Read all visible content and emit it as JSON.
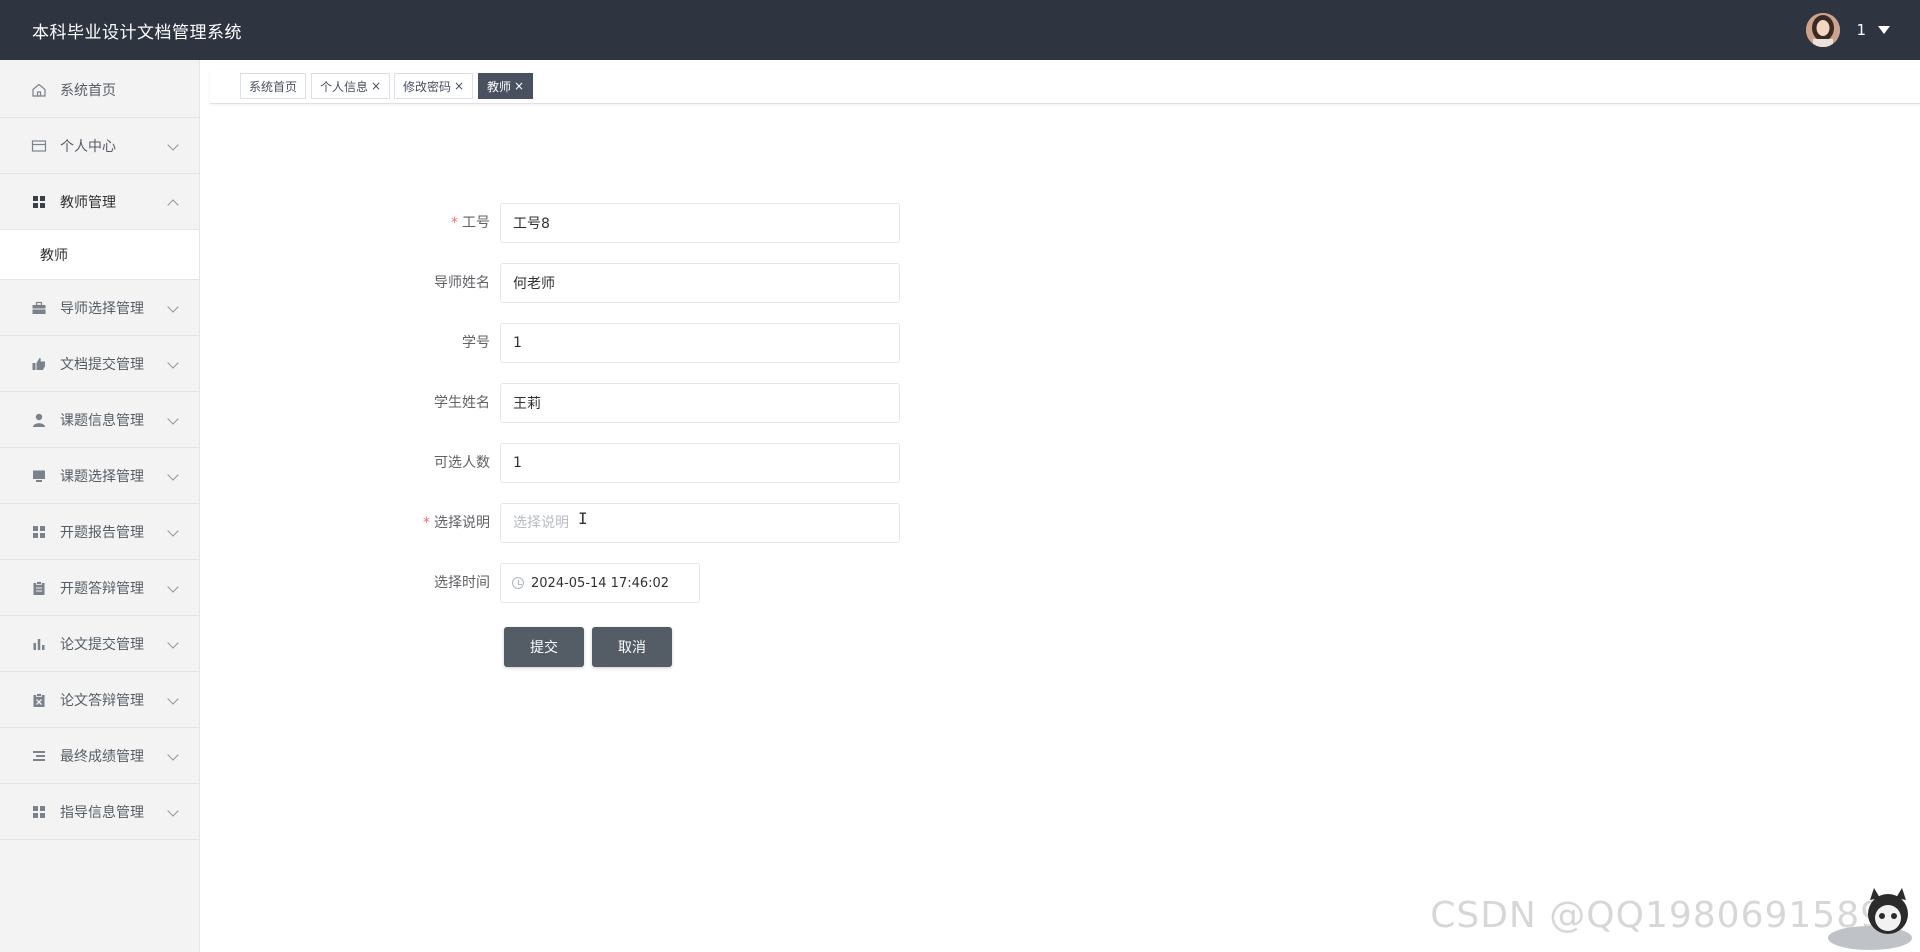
{
  "header": {
    "title": "本科毕业设计文档管理系统",
    "user_name": "1"
  },
  "sidebar": {
    "items": [
      {
        "label": "系统首页",
        "icon": "home-icon"
      },
      {
        "label": "个人中心",
        "icon": "card-icon"
      },
      {
        "label": "教师管理",
        "icon": "grid-icon",
        "expanded": true
      },
      {
        "label": "导师选择管理",
        "icon": "briefcase-icon"
      },
      {
        "label": "文档提交管理",
        "icon": "thumb-icon"
      },
      {
        "label": "课题信息管理",
        "icon": "user-icon"
      },
      {
        "label": "课题选择管理",
        "icon": "monitor-icon"
      },
      {
        "label": "开题报告管理",
        "icon": "grid-icon"
      },
      {
        "label": "开题答辩管理",
        "icon": "clipboard-icon"
      },
      {
        "label": "论文提交管理",
        "icon": "bar-chart-icon"
      },
      {
        "label": "论文答辩管理",
        "icon": "clipboard-x-icon"
      },
      {
        "label": "最终成绩管理",
        "icon": "list-icon"
      },
      {
        "label": "指导信息管理",
        "icon": "grid-icon"
      }
    ],
    "submenu": {
      "label": "教师"
    }
  },
  "tags": [
    {
      "label": "系统首页",
      "closable": false,
      "active": false
    },
    {
      "label": "个人信息",
      "closable": true,
      "active": false
    },
    {
      "label": "修改密码",
      "closable": true,
      "active": false
    },
    {
      "label": "教师",
      "closable": true,
      "active": true
    }
  ],
  "tag_close_glyph": "×",
  "form": {
    "fields": [
      {
        "label": "工号",
        "required": true,
        "value": "工号8",
        "placeholder": ""
      },
      {
        "label": "导师姓名",
        "required": false,
        "value": "何老师",
        "placeholder": ""
      },
      {
        "label": "学号",
        "required": false,
        "value": "1",
        "placeholder": ""
      },
      {
        "label": "学生姓名",
        "required": false,
        "value": "王莉",
        "placeholder": ""
      },
      {
        "label": "可选人数",
        "required": false,
        "value": "1",
        "placeholder": ""
      },
      {
        "label": "选择说明",
        "required": true,
        "value": "",
        "placeholder": "选择说明"
      },
      {
        "label": "选择时间",
        "required": false,
        "value": "2024-05-14 17:46:02",
        "placeholder": ""
      }
    ],
    "required_mark": "*",
    "submit_label": "提交",
    "cancel_label": "取消"
  },
  "watermark": "CSDN @QQ1980691589",
  "colors": {
    "header_bg": "#2e3540",
    "button_bg": "#545c66",
    "active_tag_bg": "#495060",
    "required": "#f56c6c"
  }
}
